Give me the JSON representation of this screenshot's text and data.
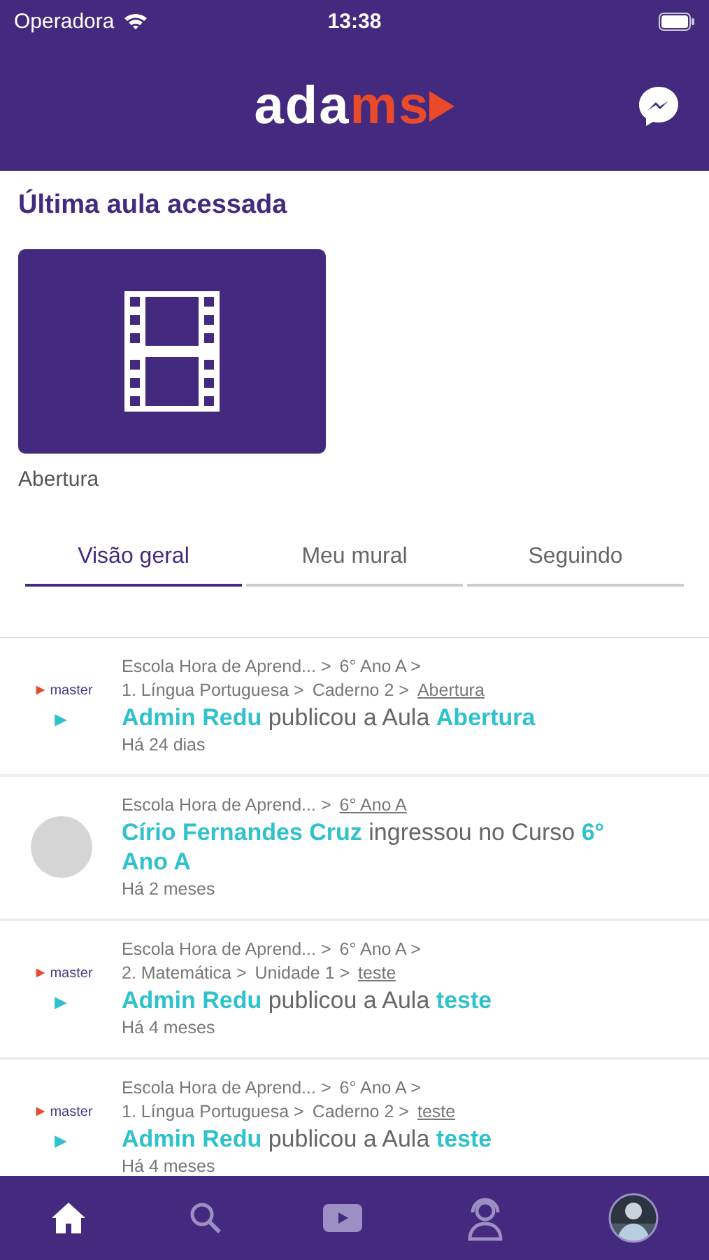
{
  "status_bar": {
    "carrier": "Operadora",
    "time": "13:38"
  },
  "header": {
    "logo": {
      "first": "ada",
      "second": "ms"
    }
  },
  "last_class": {
    "heading": "Última aula acessada",
    "title": "Abertura"
  },
  "tabs": [
    {
      "label": "Visão geral",
      "selected": true
    },
    {
      "label": "Meu mural",
      "selected": false
    },
    {
      "label": "Seguindo",
      "selected": false
    }
  ],
  "feed": [
    {
      "kind": "lesson",
      "logo": "master",
      "path": [
        [
          {
            "text": "Escola Hora de Aprend... >",
            "link": false
          },
          {
            "text": "6° Ano A >",
            "link": false
          }
        ],
        [
          {
            "text": "1. Língua Portuguesa >",
            "link": false
          },
          {
            "text": "Caderno 2 >",
            "link": false
          },
          {
            "text": "Abertura",
            "link": true
          }
        ]
      ],
      "actor": "Admin Redu",
      "verb": "publicou a Aula",
      "object": "Abertura",
      "time": "Há 24 dias"
    },
    {
      "kind": "enrollment",
      "path": [
        [
          {
            "text": "Escola Hora de Aprend... >",
            "link": false
          },
          {
            "text": "6° Ano A",
            "link": true
          }
        ]
      ],
      "actor": "Círio Fernandes Cruz",
      "verb": "ingressou no Curso",
      "object": "6° Ano A",
      "time": "Há 2 meses"
    },
    {
      "kind": "lesson",
      "logo": "master",
      "path": [
        [
          {
            "text": "Escola Hora de Aprend... >",
            "link": false
          },
          {
            "text": "6° Ano A >",
            "link": false
          }
        ],
        [
          {
            "text": "2. Matemática >",
            "link": false
          },
          {
            "text": "Unidade 1 >",
            "link": false
          },
          {
            "text": "teste",
            "link": true
          }
        ]
      ],
      "actor": "Admin Redu",
      "verb": "publicou a Aula",
      "object": "teste",
      "time": "Há 4 meses"
    },
    {
      "kind": "lesson",
      "logo": "master",
      "path": [
        [
          {
            "text": "Escola Hora de Aprend... >",
            "link": false
          },
          {
            "text": "6° Ano A >",
            "link": false
          }
        ],
        [
          {
            "text": "1. Língua Portuguesa >",
            "link": false
          },
          {
            "text": "Caderno 2 >",
            "link": false
          },
          {
            "text": "teste",
            "link": true
          }
        ]
      ],
      "actor": "Admin Redu",
      "verb": "publicou a Aula",
      "object": "teste",
      "time": "Há 4 meses"
    }
  ],
  "tab_bar": [
    {
      "kind": "home",
      "selected": true
    },
    {
      "kind": "search",
      "selected": false
    },
    {
      "kind": "video",
      "selected": false
    },
    {
      "kind": "support",
      "selected": false
    },
    {
      "kind": "profile",
      "selected": false
    }
  ]
}
